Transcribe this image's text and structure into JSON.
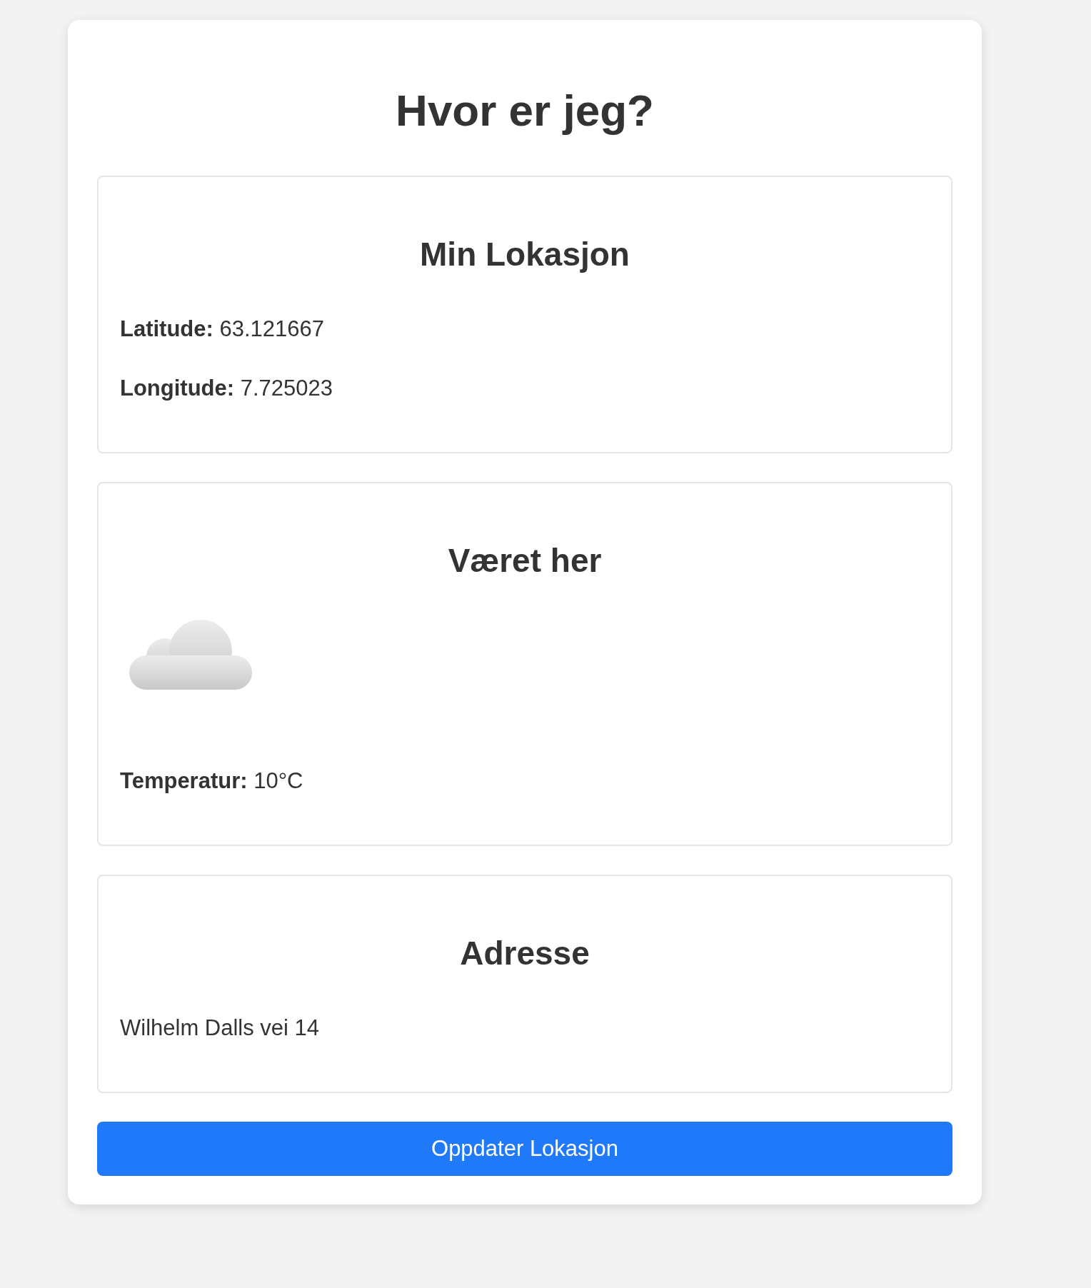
{
  "title": "Hvor er jeg?",
  "sections": [
    {
      "heading": "Min Lokasjon",
      "items": [
        {
          "kind": "field",
          "label": "Latitude:",
          "value": "63.121667"
        },
        {
          "kind": "field",
          "label": "Longitude:",
          "value": "7.725023"
        }
      ]
    },
    {
      "heading": "Været her",
      "items": [
        {
          "kind": "cloud"
        },
        {
          "kind": "field",
          "label": "Temperatur:",
          "value": "10°C"
        }
      ]
    },
    {
      "heading": "Adresse",
      "items": [
        {
          "kind": "text",
          "text": "Wilhelm Dalls vei 14"
        }
      ]
    }
  ],
  "button": "Oppdater Lokasjon"
}
